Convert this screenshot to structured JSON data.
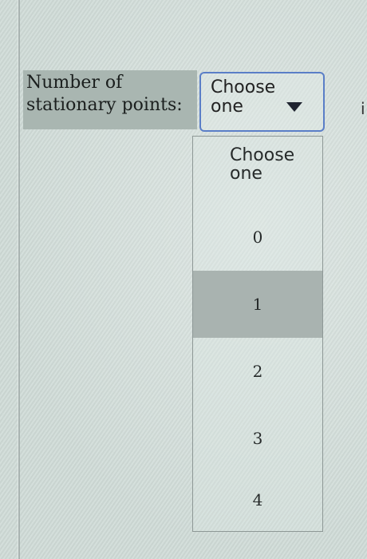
{
  "question": {
    "label_line1": "Number of",
    "label_line2": "stationary points:"
  },
  "select": {
    "selected_value": "Choose one",
    "arrow_icon": "triangle-down-icon",
    "border_color": "#5a7ec7"
  },
  "dropdown": {
    "options": [
      "Choose one",
      "0",
      "1",
      "2",
      "3",
      "4"
    ],
    "highlighted_option": "1",
    "highlight_color": "#a9b3b0"
  },
  "edge_fragment": "i"
}
